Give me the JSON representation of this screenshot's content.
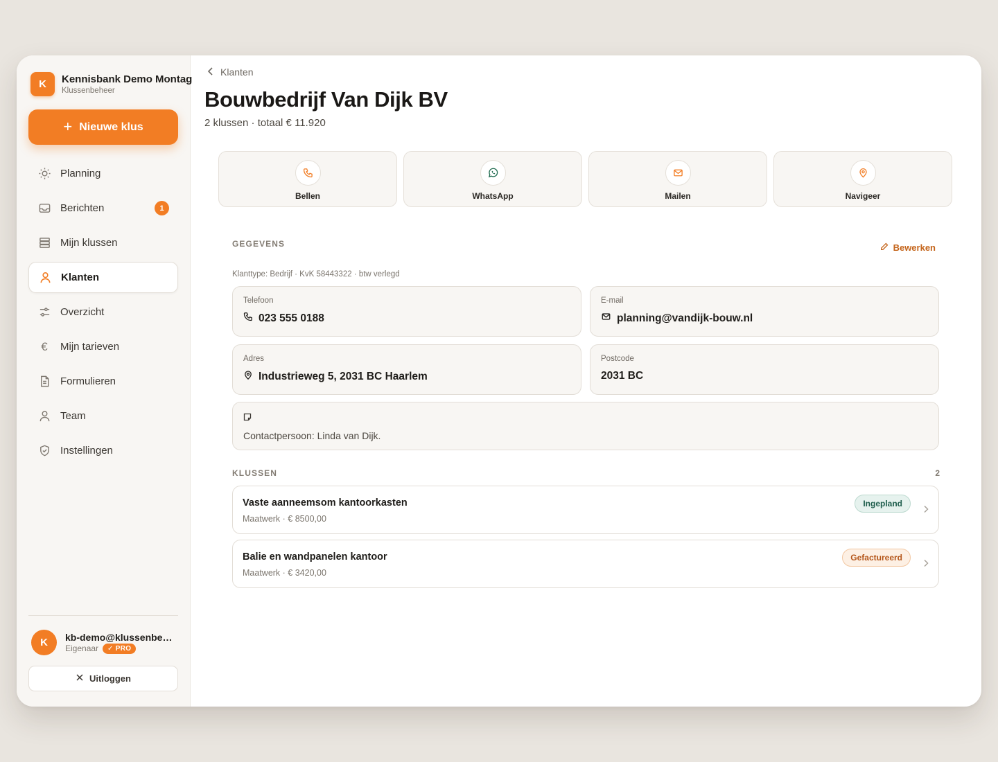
{
  "sidebar": {
    "brand_initial": "K",
    "brand_name": "Kennisbank Demo Montag",
    "brand_sub": "Klussenbeheer",
    "new_button": "Nieuwe klus",
    "items": [
      {
        "label": "Planning",
        "icon": "sun-icon"
      },
      {
        "label": "Berichten",
        "icon": "inbox-icon",
        "badge": "1"
      },
      {
        "label": "Mijn klussen",
        "icon": "stack-icon"
      },
      {
        "label": "Klanten",
        "icon": "person-icon",
        "active": true
      },
      {
        "label": "Overzicht",
        "icon": "sliders-icon"
      },
      {
        "label": "Mijn tarieven",
        "icon": "euro-icon"
      },
      {
        "label": "Formulieren",
        "icon": "document-icon"
      },
      {
        "label": "Team",
        "icon": "user-icon"
      },
      {
        "label": "Instellingen",
        "icon": "shield-icon"
      }
    ],
    "user": {
      "initial": "K",
      "email": "kb-demo@klussenbeheer.nl",
      "role": "Eigenaar",
      "plan": "✓ PRO"
    },
    "logout": "Uitloggen"
  },
  "header": {
    "breadcrumb": "Klanten",
    "title": "Bouwbedrijf Van Dijk BV",
    "subtitle": "2 klussen · totaal € 11.920"
  },
  "actions": [
    {
      "label": "Bellen",
      "icon": "phone-icon"
    },
    {
      "label": "WhatsApp",
      "icon": "whatsapp-icon"
    },
    {
      "label": "Mailen",
      "icon": "mail-icon"
    },
    {
      "label": "Navigeer",
      "icon": "map-pin-icon"
    }
  ],
  "details": {
    "section": "GEGEVENS",
    "edit": "Bewerken",
    "meta": "Klanttype: Bedrijf · KvK 58443322 · btw verlegd",
    "phone_label": "Telefoon",
    "phone": "023 555 0188",
    "email_label": "E-mail",
    "email": "planning@vandijk-bouw.nl",
    "address_label": "Adres",
    "address": "Industrieweg 5, 2031 BC Haarlem",
    "postcode_label": "Postcode",
    "postcode": "2031 BC",
    "note": "Contactpersoon: Linda van Dijk."
  },
  "jobs": {
    "section": "KLUSSEN",
    "count": "2",
    "items": [
      {
        "title": "Vaste aanneemsom kantoorkasten",
        "sub": "Maatwerk · € 8500,00",
        "status": "Ingepland"
      },
      {
        "title": "Balie en wandpanelen kantoor",
        "sub": "Maatwerk · € 3420,00",
        "status": "Gefactureerd"
      }
    ]
  },
  "colors": {
    "accent": "#f27d24",
    "status_planned": "#1f5e4d",
    "status_invoiced": "#b4561a"
  }
}
